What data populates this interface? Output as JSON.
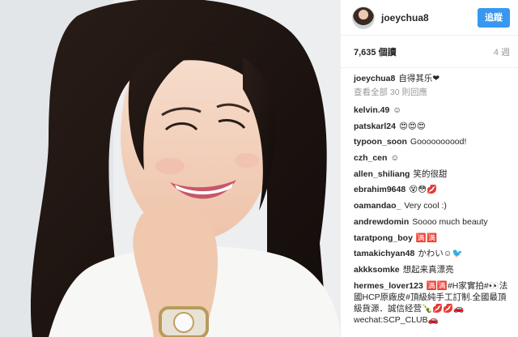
{
  "header": {
    "username": "joeychua8",
    "follow_label": "追蹤"
  },
  "stats": {
    "views": "7,635 個讀",
    "time_ago": "4 週"
  },
  "caption": {
    "user": "joeychua8",
    "text": "自得其乐❤"
  },
  "view_all": "查看全部 30 則回應",
  "comments": [
    {
      "user": "kelvin.49",
      "text": "☺"
    },
    {
      "user": "patskarl24",
      "text": "😍😍😍"
    },
    {
      "user": "typoon_soon",
      "text": "Goooooooood!"
    },
    {
      "user": "czh_cen",
      "text": "☺"
    },
    {
      "user": "allen_shiliang",
      "text": "笑的很甜"
    },
    {
      "user": "ebrahim9648",
      "text": "😵😳💋"
    },
    {
      "user": "oamandao_",
      "text": "Very cool :)"
    },
    {
      "user": "andrewdomin",
      "text": "Soooo much beauty"
    },
    {
      "user": "taratpong_boy",
      "text": "🈵🈵"
    },
    {
      "user": "tamakichyan48",
      "text": "かわい☺🐦"
    },
    {
      "user": "akkksomke",
      "text": "想起来真漂亮"
    },
    {
      "user": "hermes_lover123",
      "text": "🈵🈵#H家實拍#👀法國HCP原廠皮#頂級純手工訂制.全國最頂級貨源．誠信经营🍾💋💋🚗wechat:SCP_CLUB🚗"
    }
  ],
  "colors": {
    "follow_bg": "#3897f0",
    "muted_text": "#999999",
    "divider": "#efefef"
  }
}
